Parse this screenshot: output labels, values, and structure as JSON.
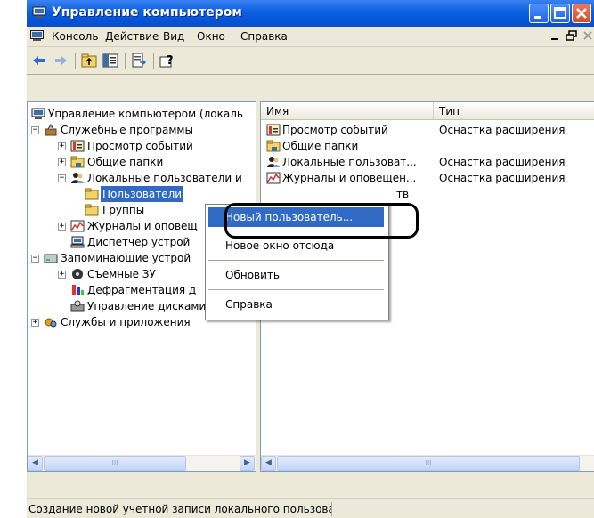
{
  "window": {
    "title": "Управление компьютером"
  },
  "menubar": {
    "items": [
      "Консоль",
      "Действие",
      "Вид",
      "Окно",
      "Справка"
    ]
  },
  "tree": {
    "items": [
      {
        "label": "Управление компьютером (локаль",
        "icon": "computer-icon"
      },
      {
        "label": "Служебные программы",
        "icon": "tools-icon"
      },
      {
        "label": "Просмотр событий",
        "icon": "event-viewer-icon"
      },
      {
        "label": "Общие папки",
        "icon": "shared-folder-icon"
      },
      {
        "label": "Локальные пользователи и",
        "icon": "users-icon"
      },
      {
        "label": "Пользователи",
        "icon": "folder-icon"
      },
      {
        "label": "Группы",
        "icon": "folder-icon"
      },
      {
        "label": "Журналы и оповещ",
        "icon": "logs-icon"
      },
      {
        "label": "Диспетчер устрой",
        "icon": "device-manager-icon"
      },
      {
        "label": "Запоминающие устрой",
        "icon": "storage-icon"
      },
      {
        "label": "Съемные ЗУ",
        "icon": "removable-storage-icon"
      },
      {
        "label": "Дефрагментация д",
        "icon": "defrag-icon"
      },
      {
        "label": "Управление дисками",
        "icon": "disk-management-icon"
      },
      {
        "label": "Службы и приложения",
        "icon": "services-icon"
      }
    ]
  },
  "list": {
    "columns": [
      "Имя",
      "Тип"
    ],
    "rows": [
      {
        "name": "Просмотр событий",
        "type": "Оснастка расширения",
        "icon": "event-viewer-icon"
      },
      {
        "name": "Общие папки",
        "type": "",
        "icon": "shared-folder-icon"
      },
      {
        "name": "Локальные пользоват...",
        "type": "Оснастка расширения",
        "icon": "users-icon"
      },
      {
        "name": "Журналы и оповещен...",
        "type": "Оснастка расширения",
        "icon": "logs-icon"
      },
      {
        "name": "тв",
        "type": "",
        "icon": ""
      }
    ]
  },
  "context_menu": {
    "items": [
      "Новый пользователь...",
      "Новое окно отсюда",
      "Обновить",
      "Справка"
    ]
  },
  "status": {
    "text": "Создание новой учетной записи локального пользовате"
  },
  "scrollbar": {
    "thumb_grip": "III"
  },
  "colors": {
    "selection": "#316ac5",
    "titlebar": "#0553d6"
  }
}
